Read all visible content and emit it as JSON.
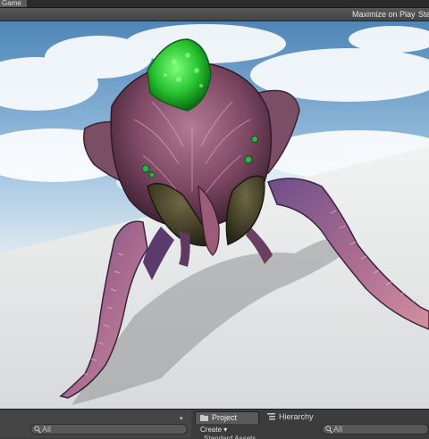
{
  "game_view": {
    "tab_label": "Game",
    "maximize_label": "Maximize on Play",
    "stats_label": "Stats"
  },
  "viewport": {
    "scene": "spider-creature-on-plane",
    "sky_color": "#7ea9cf",
    "ground_color": "#e6e8ea",
    "creature_color": "#8a4f6e",
    "crest_color": "#2fc23a"
  },
  "bottom_panel": {
    "left_search_placeholder": "All",
    "tabs": [
      {
        "label": "Project",
        "icon": "project-icon",
        "active": true
      },
      {
        "label": "Hierarchy",
        "icon": "hierarchy-icon",
        "active": false
      }
    ],
    "create_label": "Create ▾",
    "right_search_placeholder": "All",
    "first_folder": "Standard Assets"
  }
}
